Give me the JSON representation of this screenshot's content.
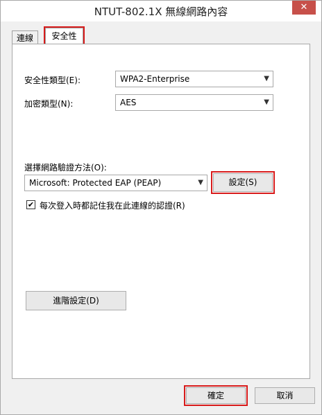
{
  "window": {
    "title": "NTUT-802.1X 無線網路內容",
    "close_label": "✕"
  },
  "tabs": [
    {
      "label": "連線",
      "active": false
    },
    {
      "label": "安全性",
      "active": true
    }
  ],
  "security": {
    "type_label": "安全性類型(E):",
    "type_value": "WPA2-Enterprise",
    "encryption_label": "加密類型(N):",
    "encryption_value": "AES",
    "auth_label": "選擇網路驗證方法(O):",
    "auth_value": "Microsoft: Protected EAP (PEAP)",
    "settings_label": "設定(S)",
    "remember_label": "每次登入時都記住我在此連線的認證(R)",
    "remember_checked": true,
    "advanced_label": "進階設定(D)"
  },
  "footer": {
    "ok_label": "確定",
    "cancel_label": "取消"
  },
  "colors": {
    "highlight": "#d81b1b"
  }
}
